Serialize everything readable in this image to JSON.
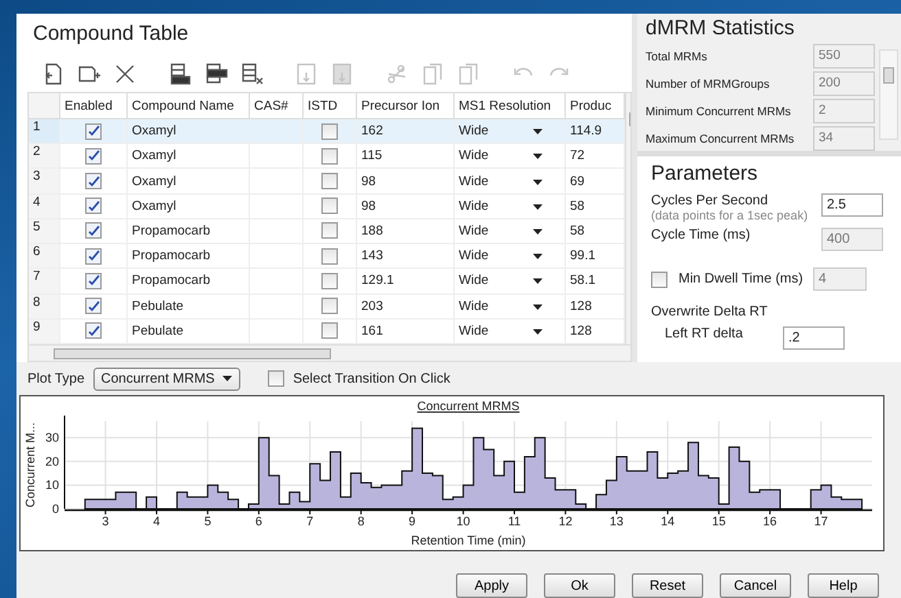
{
  "compound_table": {
    "title": "Compound Table",
    "toolbar": [
      {
        "kind": "import",
        "disabled": false
      },
      {
        "kind": "add",
        "disabled": false
      },
      {
        "kind": "delete",
        "disabled": false
      },
      {
        "kind": "insert-above",
        "disabled": false
      },
      {
        "kind": "insert-below",
        "disabled": false
      },
      {
        "kind": "clear",
        "disabled": false
      },
      {
        "kind": "save",
        "disabled": true
      },
      {
        "kind": "save-as",
        "disabled": true
      },
      {
        "kind": "cut",
        "disabled": true
      },
      {
        "kind": "copy",
        "disabled": true
      },
      {
        "kind": "paste",
        "disabled": true
      },
      {
        "kind": "undo",
        "disabled": true
      },
      {
        "kind": "redo",
        "disabled": true
      }
    ],
    "columns": [
      "Enabled",
      "Compound Name",
      "CAS#",
      "ISTD",
      "Precursor Ion",
      "MS1 Resolution",
      "Produc"
    ],
    "rows": [
      {
        "number": "1",
        "enabled": true,
        "compound_name": "Oxamyl",
        "istd": false,
        "precursor_ion": "162",
        "ms1_resolution": "Wide",
        "product": "114.9",
        "selected": true
      },
      {
        "number": "2",
        "enabled": true,
        "compound_name": "Oxamyl",
        "istd": false,
        "precursor_ion": "115",
        "ms1_resolution": "Wide",
        "product": "72",
        "selected": false
      },
      {
        "number": "3",
        "enabled": true,
        "compound_name": "Oxamyl",
        "istd": false,
        "precursor_ion": "98",
        "ms1_resolution": "Wide",
        "product": "69",
        "selected": false
      },
      {
        "number": "4",
        "enabled": true,
        "compound_name": "Oxamyl",
        "istd": false,
        "precursor_ion": "98",
        "ms1_resolution": "Wide",
        "product": "58",
        "selected": false
      },
      {
        "number": "5",
        "enabled": true,
        "compound_name": "Propamocarb",
        "istd": false,
        "precursor_ion": "188",
        "ms1_resolution": "Wide",
        "product": "58",
        "selected": false
      },
      {
        "number": "6",
        "enabled": true,
        "compound_name": "Propamocarb",
        "istd": false,
        "precursor_ion": "143",
        "ms1_resolution": "Wide",
        "product": "99.1",
        "selected": false
      },
      {
        "number": "7",
        "enabled": true,
        "compound_name": "Propamocarb",
        "istd": false,
        "precursor_ion": "129.1",
        "ms1_resolution": "Wide",
        "product": "58.1",
        "selected": false
      },
      {
        "number": "8",
        "enabled": true,
        "compound_name": "Pebulate",
        "istd": false,
        "precursor_ion": "203",
        "ms1_resolution": "Wide",
        "product": "128",
        "selected": false
      },
      {
        "number": "9",
        "enabled": true,
        "compound_name": "Pebulate",
        "istd": false,
        "precursor_ion": "161",
        "ms1_resolution": "Wide",
        "product": "128",
        "selected": false
      }
    ]
  },
  "dmrm_statistics": {
    "title": "dMRM Statistics",
    "fields": [
      {
        "label": "Total MRMs",
        "value": "550"
      },
      {
        "label": "Number of MRMGroups",
        "value": "200"
      },
      {
        "label": "Minimum Concurrent MRMs",
        "value": "2"
      },
      {
        "label": "Maximum Concurrent MRMs",
        "value": "34"
      }
    ]
  },
  "parameters": {
    "title": "Parameters",
    "cycles_per_second": {
      "label": "Cycles Per Second",
      "hint": "(data points for a 1sec peak)",
      "value": "2.5"
    },
    "cycle_time": {
      "label": "Cycle Time (ms)",
      "value": "400",
      "disabled": true
    },
    "min_dwell_time": {
      "label": "Min Dwell Time (ms)",
      "checked": false,
      "value": "4"
    },
    "overwrite_delta_rt": {
      "label": "Overwrite Delta RT"
    },
    "left_rt_delta": {
      "label": "Left RT delta",
      "value": ".2"
    }
  },
  "plot_options": {
    "plot_type_label": "Plot Type",
    "plot_type": "Concurrent MRMS",
    "select_transition": {
      "label": "Select Transition On Click",
      "checked": false
    }
  },
  "plot": {
    "chart_data": {
      "type": "area",
      "title": "Concurrent MRMS",
      "xlabel": "Retention Time (min)",
      "ylabel": "Concurrent M...",
      "xlim": [
        2.2,
        18
      ],
      "ylim": [
        0,
        37
      ],
      "xticks": [
        3,
        4,
        5,
        6,
        7,
        8,
        9,
        10,
        11,
        12,
        13,
        14,
        15,
        16,
        17
      ],
      "yticks": [
        0,
        10,
        20,
        30
      ],
      "x": [
        2.6,
        2.8,
        3.0,
        3.2,
        3.4,
        3.6,
        3.8,
        4.0,
        4.2,
        4.4,
        4.6,
        4.8,
        5.0,
        5.2,
        5.4,
        5.6,
        5.8,
        6.0,
        6.2,
        6.4,
        6.6,
        6.8,
        7.0,
        7.2,
        7.4,
        7.6,
        7.8,
        8.0,
        8.2,
        8.4,
        8.6,
        8.8,
        9.0,
        9.2,
        9.4,
        9.6,
        9.8,
        10.0,
        10.2,
        10.4,
        10.6,
        10.8,
        11.0,
        11.2,
        11.4,
        11.6,
        11.8,
        12.0,
        12.2,
        12.4,
        12.6,
        12.8,
        13.0,
        13.2,
        13.4,
        13.6,
        13.8,
        14.0,
        14.2,
        14.4,
        14.6,
        14.8,
        15.0,
        15.2,
        15.4,
        15.6,
        15.8,
        16.0,
        16.2,
        16.4,
        16.6,
        16.8,
        17.0,
        17.2,
        17.4,
        17.6,
        17.8
      ],
      "grid": true,
      "series": [
        {
          "color": "#b9b4dc",
          "values": [
            4,
            4,
            4,
            7,
            7,
            0,
            5,
            0,
            0,
            7,
            5,
            5,
            10,
            7,
            4,
            0,
            2,
            30,
            14,
            2,
            7,
            3,
            19,
            12,
            24,
            5,
            15,
            11,
            9,
            10,
            10,
            16,
            34,
            15,
            14,
            4,
            5,
            10,
            30,
            25,
            14,
            20,
            7,
            22,
            30,
            13,
            8,
            8,
            2,
            0,
            6,
            12,
            22,
            16,
            16,
            24,
            13,
            15,
            16,
            28,
            14,
            13,
            2,
            26,
            20,
            7,
            8,
            8,
            0,
            0,
            0,
            8,
            10,
            5,
            4,
            4,
            4
          ]
        }
      ]
    }
  },
  "buttons": [
    "Apply",
    "Ok",
    "Reset",
    "Cancel",
    "Help"
  ]
}
